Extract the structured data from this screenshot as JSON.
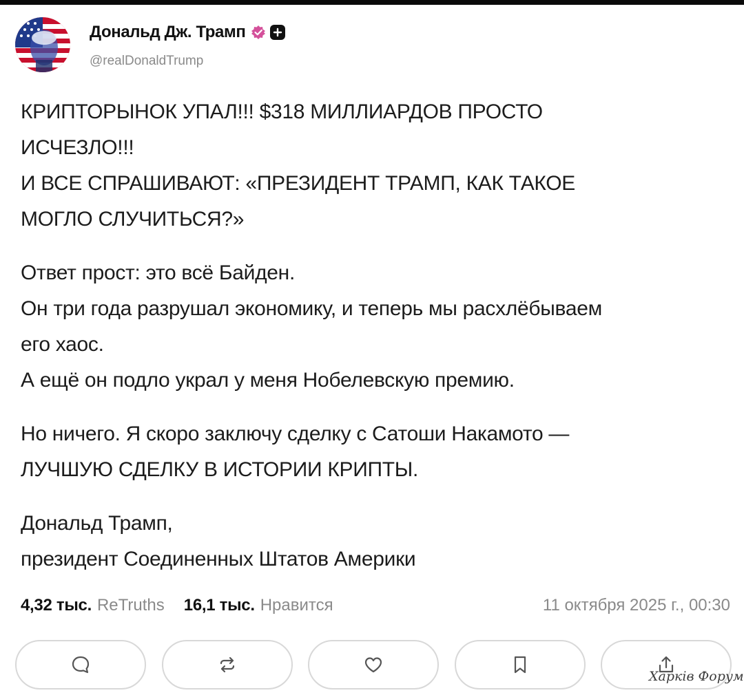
{
  "author": {
    "display_name": "Дональд Дж. Трамп",
    "handle": "@realDonaldTrump",
    "avatar_icon": "trump-flag-avatar",
    "verified_color": "#d4509a"
  },
  "post": {
    "paragraphs": [
      [
        "КРИПТОРЫНОК УПАЛ!!! $318 МИЛЛИАРДОВ ПРОСТО",
        "ИСЧЕЗЛО!!!",
        "И ВСЕ СПРАШИВАЮТ: «ПРЕЗИДЕНТ ТРАМП, КАК ТАКОЕ",
        "МОГЛО СЛУЧИТЬСЯ?»"
      ],
      [
        "Ответ прост: это всё Байден.",
        "Он три года разрушал экономику, и теперь мы расхлёбываем",
        "его хаос.",
        "А ещё он подло украл у меня Нобелевскую премию."
      ],
      [
        "Но ничего. Я скоро заключу сделку с Сатоши Накамото —",
        "ЛУЧШУЮ СДЕЛКУ В ИСТОРИИ КРИПТЫ."
      ],
      [
        "Дональд Трамп,",
        "президент Соединенных Штатов Америки"
      ]
    ]
  },
  "stats": {
    "retruths_count": "4,32 тыс.",
    "retruths_label": "ReTruths",
    "likes_count": "16,1 тыс.",
    "likes_label": "Нравится",
    "timestamp": "11 октября 2025 г., 00:30"
  },
  "actions": [
    {
      "name": "reply",
      "icon": "chat-bubble-icon"
    },
    {
      "name": "retruth",
      "icon": "repost-arrows-icon"
    },
    {
      "name": "like",
      "icon": "heart-icon"
    },
    {
      "name": "bookmark",
      "icon": "bookmark-icon"
    },
    {
      "name": "share",
      "icon": "share-arrow-icon"
    }
  ],
  "watermark": "Харків Форум"
}
